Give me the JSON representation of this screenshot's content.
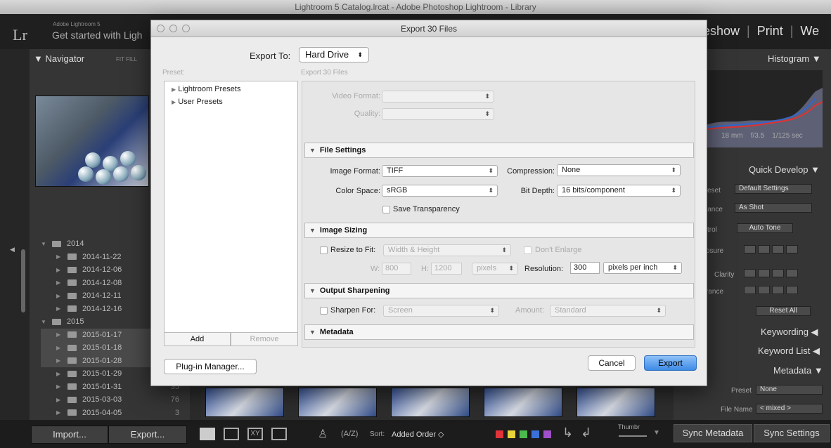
{
  "window": {
    "title": "Lightroom 5 Catalog.lrcat - Adobe Photoshop Lightroom - Library"
  },
  "lr": {
    "logo": "Lr",
    "product": "Adobe Lightroom 5",
    "identity": "Get started with Ligh",
    "modules": [
      "eshow",
      "Print",
      "We"
    ]
  },
  "left": {
    "navigator": "Navigator",
    "nav_options": "FIT   FILL",
    "folders": [
      {
        "name": "2014",
        "count": "",
        "level": 0,
        "expanded": true
      },
      {
        "name": "2014-11-22",
        "count": "",
        "level": 1
      },
      {
        "name": "2014-12-06",
        "count": "",
        "level": 1
      },
      {
        "name": "2014-12-08",
        "count": "",
        "level": 1
      },
      {
        "name": "2014-12-11",
        "count": "",
        "level": 1
      },
      {
        "name": "2014-12-16",
        "count": "",
        "level": 1
      },
      {
        "name": "2015",
        "count": "",
        "level": 0,
        "expanded": true
      },
      {
        "name": "2015-01-17",
        "count": "",
        "level": 1
      },
      {
        "name": "2015-01-18",
        "count": "",
        "level": 1
      },
      {
        "name": "2015-01-28",
        "count": "",
        "level": 1
      },
      {
        "name": "2015-01-29",
        "count": "",
        "level": 1
      },
      {
        "name": "2015-01-31",
        "count": "35",
        "level": 1
      },
      {
        "name": "2015-03-03",
        "count": "76",
        "level": 1
      },
      {
        "name": "2015-04-05",
        "count": "3",
        "level": 1
      }
    ],
    "import_label": "Import...",
    "export_label": "Export..."
  },
  "right": {
    "histogram": "Histogram",
    "cam_info": [
      "18 mm",
      "f/3.5",
      "1/125 sec"
    ],
    "quick_develop": "Quick Develop",
    "preset_lbl": "eset",
    "preset_val": "Default Settings",
    "wb_lbl": "lance",
    "wb_val": "As Shot",
    "tone_lbl": "trol",
    "auto_tone": "Auto Tone",
    "exposure_lbl": "osure",
    "clarity_lbl": "Clarity",
    "vibrance_lbl": "rance",
    "reset_all": "Reset All",
    "keywording": "Keywording",
    "keyword_list": "Keyword List",
    "metadata": "Metadata",
    "meta_preset_lbl": "Preset",
    "meta_preset_val": "None",
    "filename_lbl": "File Name",
    "filename_val": "< mixed >",
    "sync_metadata": "Sync Metadata",
    "sync_settings": "Sync Settings"
  },
  "toolbar": {
    "sort_label": "Sort:",
    "sort_value": "Added Order",
    "thumbs_label": "Thumbr",
    "colors": [
      "#e0333a",
      "#e8d43a",
      "#4cbb4c",
      "#3a70d8",
      "#a050c8"
    ]
  },
  "dialog": {
    "title": "Export 30 Files",
    "export_to_label": "Export To:",
    "export_to_value": "Hard Drive",
    "preset_label": "Preset:",
    "presets": [
      "Lightroom Presets",
      "User Presets"
    ],
    "add": "Add",
    "remove": "Remove",
    "right_label": "Export 30 Files",
    "video_format_label": "Video Format:",
    "quality_label": "Quality:",
    "file_settings": {
      "title": "File Settings",
      "image_format_label": "Image Format:",
      "image_format": "TIFF",
      "compression_label": "Compression:",
      "compression": "None",
      "color_space_label": "Color Space:",
      "color_space": "sRGB",
      "bit_depth_label": "Bit Depth:",
      "bit_depth": "16 bits/component",
      "save_transparency": "Save Transparency"
    },
    "image_sizing": {
      "title": "Image Sizing",
      "resize_label": "Resize to Fit:",
      "resize_value": "Width & Height",
      "dont_enlarge": "Don't Enlarge",
      "w_label": "W:",
      "w_value": "800",
      "h_label": "H:",
      "h_value": "1200",
      "units": "pixels",
      "resolution_label": "Resolution:",
      "resolution": "300",
      "res_units": "pixels per inch"
    },
    "output_sharpening": {
      "title": "Output Sharpening",
      "sharpen_for_label": "Sharpen For:",
      "sharpen_for": "Screen",
      "amount_label": "Amount:",
      "amount": "Standard"
    },
    "metadata": {
      "title": "Metadata"
    },
    "plugin_manager": "Plug-in Manager...",
    "cancel": "Cancel",
    "export": "Export"
  }
}
